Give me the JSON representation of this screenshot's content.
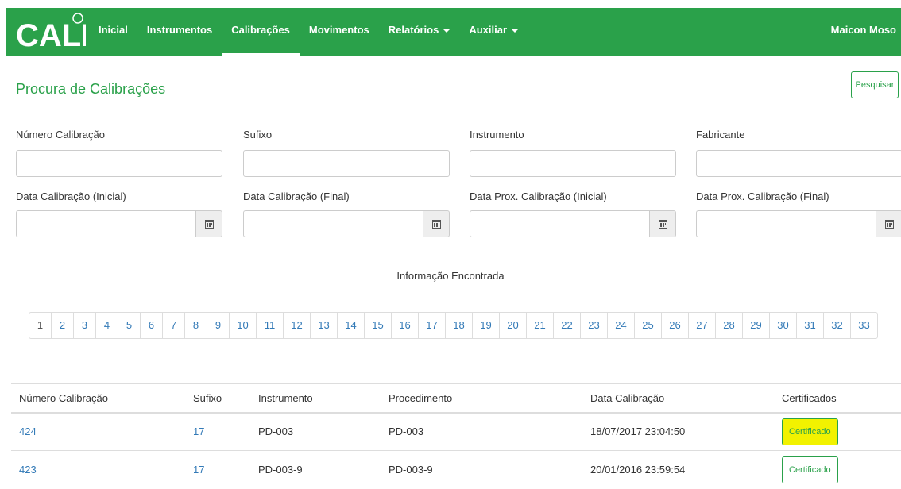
{
  "nav": {
    "logo_text": "CALI",
    "items": [
      {
        "label": "Inicial",
        "active": false,
        "dropdown": false
      },
      {
        "label": "Instrumentos",
        "active": false,
        "dropdown": false
      },
      {
        "label": "Calibrações",
        "active": true,
        "dropdown": false
      },
      {
        "label": "Movimentos",
        "active": false,
        "dropdown": false
      },
      {
        "label": "Relatórios",
        "active": false,
        "dropdown": true
      },
      {
        "label": "Auxiliar",
        "active": false,
        "dropdown": true
      }
    ],
    "user": "Maicon Moso",
    "brand_color": "#2aa14a"
  },
  "page": {
    "title": "Procura de Calibrações",
    "search_button": "Pesquisar"
  },
  "filters": {
    "numero": {
      "label": "Número Calibração",
      "value": ""
    },
    "sufixo": {
      "label": "Sufixo",
      "value": ""
    },
    "instrumento": {
      "label": "Instrumento",
      "value": ""
    },
    "fabricante": {
      "label": "Fabricante",
      "value": ""
    },
    "data_cal_inicial": {
      "label": "Data Calibração (Inicial)",
      "value": ""
    },
    "data_cal_final": {
      "label": "Data Calibração (Final)",
      "value": ""
    },
    "data_prox_inicial": {
      "label": "Data Prox. Calibração (Inicial)",
      "value": ""
    },
    "data_prox_final": {
      "label": "Data Prox. Calibração (Final)",
      "value": ""
    }
  },
  "info_found": "Informação Encontrada",
  "pagination": {
    "pages": [
      "1",
      "2",
      "3",
      "4",
      "5",
      "6",
      "7",
      "8",
      "9",
      "10",
      "11",
      "12",
      "13",
      "14",
      "15",
      "16",
      "17",
      "18",
      "19",
      "20",
      "21",
      "22",
      "23",
      "24",
      "25",
      "26",
      "27",
      "28",
      "29",
      "30",
      "31",
      "32",
      "33"
    ],
    "current": "1"
  },
  "table": {
    "headers": [
      "Número Calibração",
      "Sufixo",
      "Instrumento",
      "Procedimento",
      "Data Calibração",
      "Certificados"
    ],
    "rows": [
      {
        "numero": "424",
        "sufixo": "17",
        "instrumento": "PD-003",
        "procedimento": "PD-003",
        "data": "18/07/2017 23:04:50",
        "certificado": "Certificado",
        "highlight": true
      },
      {
        "numero": "423",
        "sufixo": "17",
        "instrumento": "PD-003-9",
        "procedimento": "PD-003-9",
        "data": "20/01/2016 23:59:54",
        "certificado": "Certificado",
        "highlight": false
      }
    ]
  }
}
